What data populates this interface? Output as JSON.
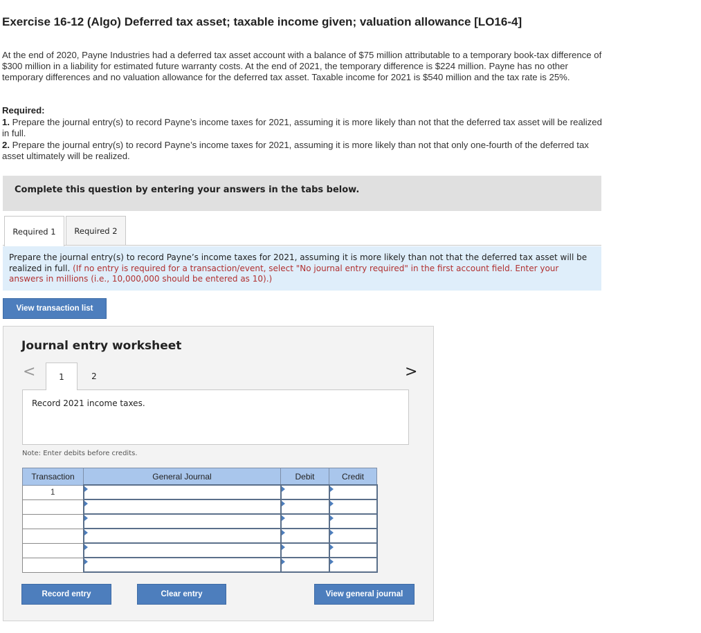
{
  "title": "Exercise 16-12 (Algo) Deferred tax asset; taxable income given; valuation allowance [LO16-4]",
  "problem_text": "At the end of 2020, Payne Industries had a deferred tax asset account with a balance of $75 million attributable to a temporary book-tax difference of $300 million in a liability for estimated future warranty costs. At the end of 2021, the temporary difference is $224 million. Payne has no other temporary differences and no valuation allowance for the deferred tax asset. Taxable income for 2021 is $540 million and the tax rate is 25%.",
  "required": {
    "heading": "Required:",
    "item1_num": "1.",
    "item1_text": "Prepare the journal entry(s) to record Payne’s income taxes for 2021, assuming it is more likely than not that the deferred tax asset will be realized in full.",
    "item2_num": "2.",
    "item2_text": "Prepare the journal entry(s) to record Payne’s income taxes for 2021, assuming it is more likely than not that only one-fourth of the deferred tax asset ultimately will be realized."
  },
  "instruction_banner": "Complete this question by entering your answers in the tabs below.",
  "tabs": [
    {
      "label": "Required 1",
      "active": true
    },
    {
      "label": "Required 2",
      "active": false
    }
  ],
  "prompt": {
    "text": "Prepare the journal entry(s) to record Payne’s income taxes for 2021, assuming it is more likely than not that the deferred tax asset will be realized in full.",
    "hint": "(If no entry is required for a transaction/event, select \"No journal entry required\" in the first account field. Enter your answers in millions (i.e., 10,000,000 should be entered as 10).)"
  },
  "buttons": {
    "view_transaction_list": "View transaction list",
    "record_entry": "Record entry",
    "clear_entry": "Clear entry",
    "view_general_journal": "View general journal"
  },
  "worksheet": {
    "title": "Journal entry worksheet",
    "prev_arrow": "<",
    "next_arrow": ">",
    "pages": [
      "1",
      "2"
    ],
    "active_page": "1",
    "description": "Record 2021 income taxes.",
    "note": "Note: Enter debits before credits.",
    "columns": [
      "Transaction",
      "General Journal",
      "Debit",
      "Credit"
    ],
    "rows": [
      {
        "transaction": "1",
        "account": "",
        "debit": "",
        "credit": ""
      },
      {
        "transaction": "",
        "account": "",
        "debit": "",
        "credit": ""
      },
      {
        "transaction": "",
        "account": "",
        "debit": "",
        "credit": ""
      },
      {
        "transaction": "",
        "account": "",
        "debit": "",
        "credit": ""
      },
      {
        "transaction": "",
        "account": "",
        "debit": "",
        "credit": ""
      },
      {
        "transaction": "",
        "account": "",
        "debit": "",
        "credit": ""
      }
    ]
  },
  "colors": {
    "button_blue": "#4d7ebd",
    "header_blue": "#a9c6ec",
    "prompt_bg": "#dfeefa",
    "hint_red": "#b03030"
  }
}
